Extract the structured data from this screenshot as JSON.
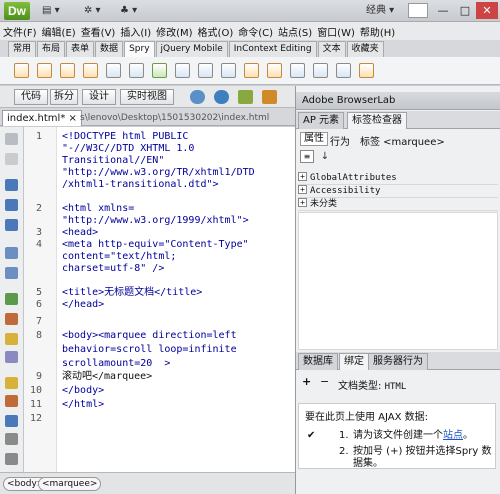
{
  "app": {
    "logo": "Dw",
    "workspace": "经典",
    "window_controls": [
      "—",
      "□",
      "✕"
    ]
  },
  "menu": [
    "文件(F)",
    "编辑(E)",
    "查看(V)",
    "插入(I)",
    "修改(M)",
    "格式(O)",
    "命令(C)",
    "站点(S)",
    "窗口(W)",
    "帮助(H)"
  ],
  "insert_tabs": [
    "常用",
    "布局",
    "表单",
    "数据",
    "Spry",
    "jQuery Mobile",
    "InContext Editing",
    "文本",
    "收藏夹"
  ],
  "insert_tabs_active": "Spry",
  "doc_toolbar": {
    "code": "代码",
    "split": "拆分",
    "design": "设计",
    "live": "实时视图"
  },
  "file": {
    "tab": "index.html*",
    "path": "s\\lenovo\\Desktop\\1501530202\\index.html"
  },
  "code_lines": [
    {
      "n": "1",
      "segments": [
        "<!DOCTYPE html PUBLIC",
        "\"-//W3C//DTD XHTML 1.0",
        "Transitional//EN\"",
        "\"http://www.w3.org/TR/xhtml1/DTD",
        "/xhtml1-transitional.dtd\">"
      ]
    },
    {
      "n": "2",
      "segments": [
        "<html xmlns=",
        "\"http://www.w3.org/1999/xhtml\">"
      ]
    },
    {
      "n": "3",
      "segments": [
        "<head>"
      ]
    },
    {
      "n": "4",
      "segments": [
        "<meta http-equiv=\"Content-Type\"",
        "content=\"text/html;",
        "charset=utf-8\" />"
      ]
    },
    {
      "n": "5",
      "segments": [
        "<title>无标题文档</title>"
      ]
    },
    {
      "n": "6",
      "segments": [
        "</head>"
      ]
    },
    {
      "n": "7",
      "segments": [
        ""
      ]
    },
    {
      "n": "8",
      "segments": [
        "<body><marquee direction=left",
        "behavior=scroll loop=infinite",
        "scrollamount=20  >"
      ]
    },
    {
      "n": "9",
      "segments": [
        "滚动吧</marquee>"
      ]
    },
    {
      "n": "10",
      "segments": [
        "</body>"
      ]
    },
    {
      "n": "11",
      "segments": [
        "</html>"
      ]
    },
    {
      "n": "12",
      "segments": [
        ""
      ]
    }
  ],
  "tag_selector": [
    "<body>",
    "<marquee>"
  ],
  "panels": {
    "browserlab": "Adobe BrowserLab",
    "ap_tab": "AP 元素",
    "tag_inspector_tab": "标签检查器",
    "attr_tab": "属性",
    "behavior_tab": "行为",
    "tag_label": "标签 <marquee>",
    "categories": [
      "GlobalAttributes",
      "Accessibility",
      "未分类"
    ],
    "bottom_tabs": [
      "数据库",
      "绑定",
      "服务器行为"
    ],
    "bottom_active": "绑定",
    "doc_type_label": "文档类型:",
    "doc_type_value": "HTML",
    "spry_heading": "要在此页上使用 AJAX 数据:",
    "step1_num": "1.",
    "step1_text": "请为该文件创建一个",
    "step1_link": "站点",
    "step1_end": "。",
    "step2_num": "2.",
    "step2_text_a": "按加号 (+) 按钮并选择Spry 数",
    "step2_text_b": "据集。",
    "check": "✔"
  }
}
